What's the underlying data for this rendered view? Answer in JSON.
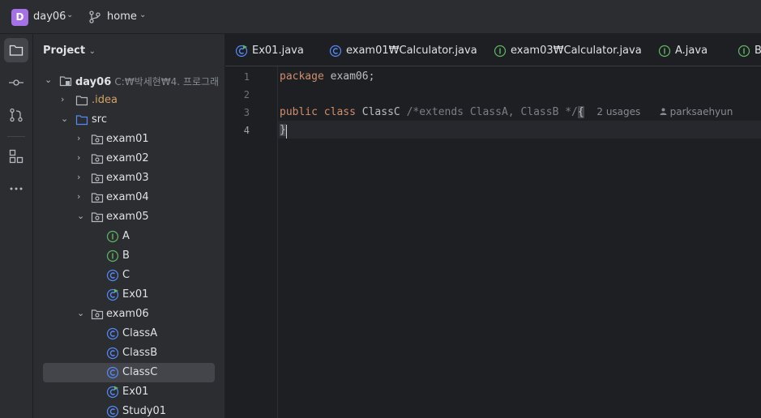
{
  "titlebar": {
    "project_badge": "D",
    "project_name": "day06",
    "branch_name": "home"
  },
  "toolstrip": {
    "tools": [
      "folder-icon",
      "commit-icon",
      "pull-requests-icon",
      "structure-icon",
      "more-icon"
    ]
  },
  "project_panel": {
    "title": "Project",
    "root": {
      "name": "day06",
      "path": "C:₩박세현₩4. 프로그래"
    },
    "items": [
      {
        "label": "src"
      },
      {
        "label": ".idea"
      },
      {
        "label": "exam01"
      },
      {
        "label": "exam02"
      },
      {
        "label": "exam03"
      },
      {
        "label": "exam04"
      },
      {
        "label": "exam05"
      },
      {
        "label": "A"
      },
      {
        "label": "B"
      },
      {
        "label": "C"
      },
      {
        "label": "Ex01"
      },
      {
        "label": "exam06"
      },
      {
        "label": "ClassA"
      },
      {
        "label": "ClassB"
      },
      {
        "label": "ClassC"
      },
      {
        "label": "Ex01"
      },
      {
        "label": "Study01"
      }
    ]
  },
  "tabs": [
    {
      "label": "Ex01.java"
    },
    {
      "label": "exam01₩Calculator.java"
    },
    {
      "label": "exam03₩Calculator.java"
    },
    {
      "label": "A.java"
    },
    {
      "label": "B"
    }
  ],
  "editor": {
    "line_numbers": [
      "1",
      "2",
      "3",
      "4"
    ],
    "line1_kw": "package",
    "line1_rest": " exam06;",
    "line3_kw1": "public",
    "line3_kw2": "class",
    "line3_name": " ClassC ",
    "line3_comment": "/*extends ClassA, ClassB */",
    "line3_brace": "{",
    "line3_usages": "2 usages",
    "line3_author": "parksaehyun",
    "line4_brace": "}"
  },
  "colors": {
    "keyword": "#cf8e6d",
    "comment": "#7a7e85",
    "class_icon": "#548af7",
    "interface_icon": "#5fb865",
    "project_badge": "#a571e6"
  }
}
